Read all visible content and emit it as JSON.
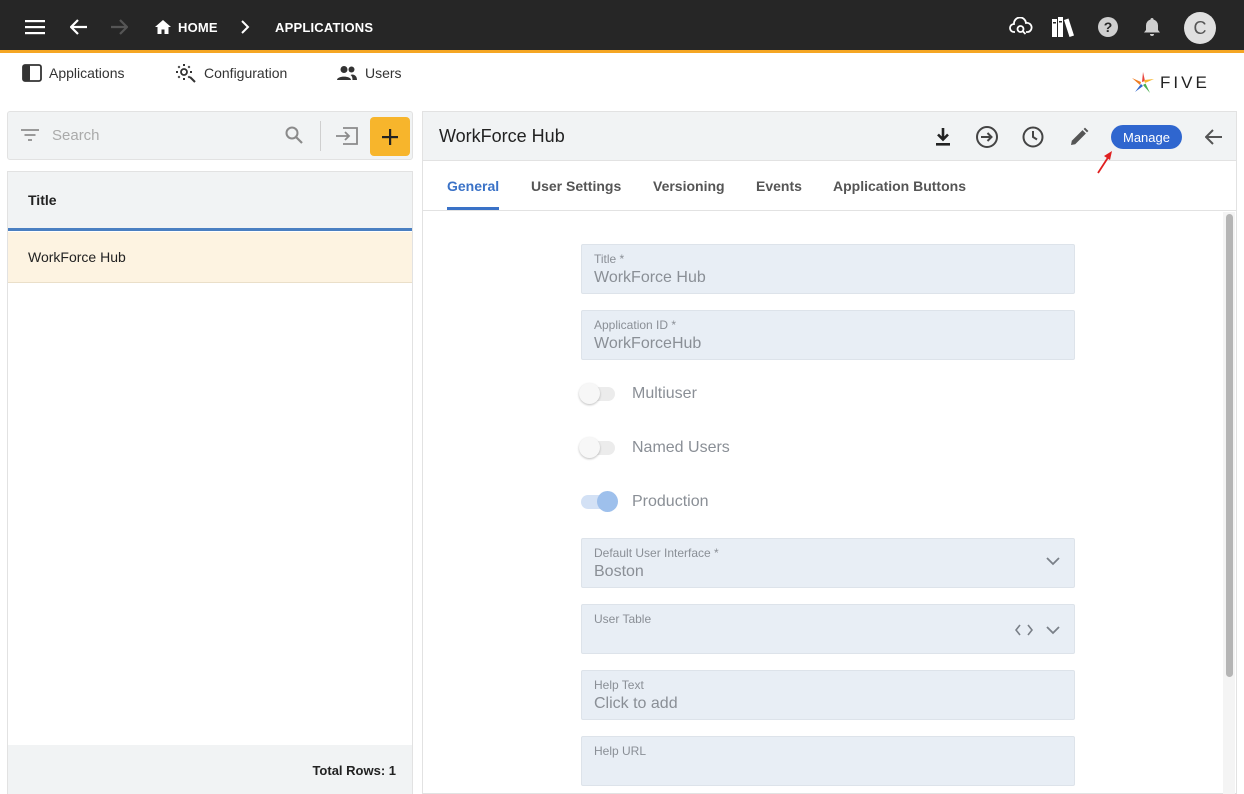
{
  "topbar": {
    "breadcrumb_home": "HOME",
    "breadcrumb_current": "APPLICATIONS",
    "avatar_initial": "C"
  },
  "subnav": {
    "applications": "Applications",
    "configuration": "Configuration",
    "users": "Users"
  },
  "logo": {
    "text": "FIVE"
  },
  "search": {
    "placeholder": "Search"
  },
  "list": {
    "column_title": "Title",
    "rows": [
      "WorkForce Hub"
    ],
    "footer": "Total Rows: 1"
  },
  "form": {
    "title": "WorkForce Hub",
    "manage_label": "Manage",
    "tabs": [
      "General",
      "User Settings",
      "Versioning",
      "Events",
      "Application Buttons"
    ],
    "fields": {
      "title": {
        "label": "Title *",
        "value": "WorkForce Hub"
      },
      "app_id": {
        "label": "Application ID *",
        "value": "WorkForceHub"
      },
      "multiuser": {
        "label": "Multiuser",
        "on": false
      },
      "named_users": {
        "label": "Named Users",
        "on": false
      },
      "production": {
        "label": "Production",
        "on": true
      },
      "default_ui": {
        "label": "Default User Interface *",
        "value": "Boston"
      },
      "user_table": {
        "label": "User Table",
        "value": ""
      },
      "help_text": {
        "label": "Help Text",
        "value": "Click to add"
      },
      "help_url": {
        "label": "Help URL",
        "value": ""
      }
    }
  },
  "colors": {
    "topbar": "#262626",
    "accent_orange": "#f7b52c",
    "accent_blue": "#2f66cf",
    "selected_row": "#fdf3e1",
    "field_bg": "#e8eef5"
  },
  "icons": {
    "topbar": [
      "menu-icon",
      "back-arrow-icon",
      "forward-arrow-icon",
      "home-icon",
      "chevron-right-icon",
      "cloud-search-icon",
      "library-icon",
      "help-icon",
      "bell-icon"
    ],
    "form_header": [
      "download-icon",
      "deploy-icon",
      "history-icon",
      "edit-icon",
      "back-arrow-icon"
    ]
  }
}
